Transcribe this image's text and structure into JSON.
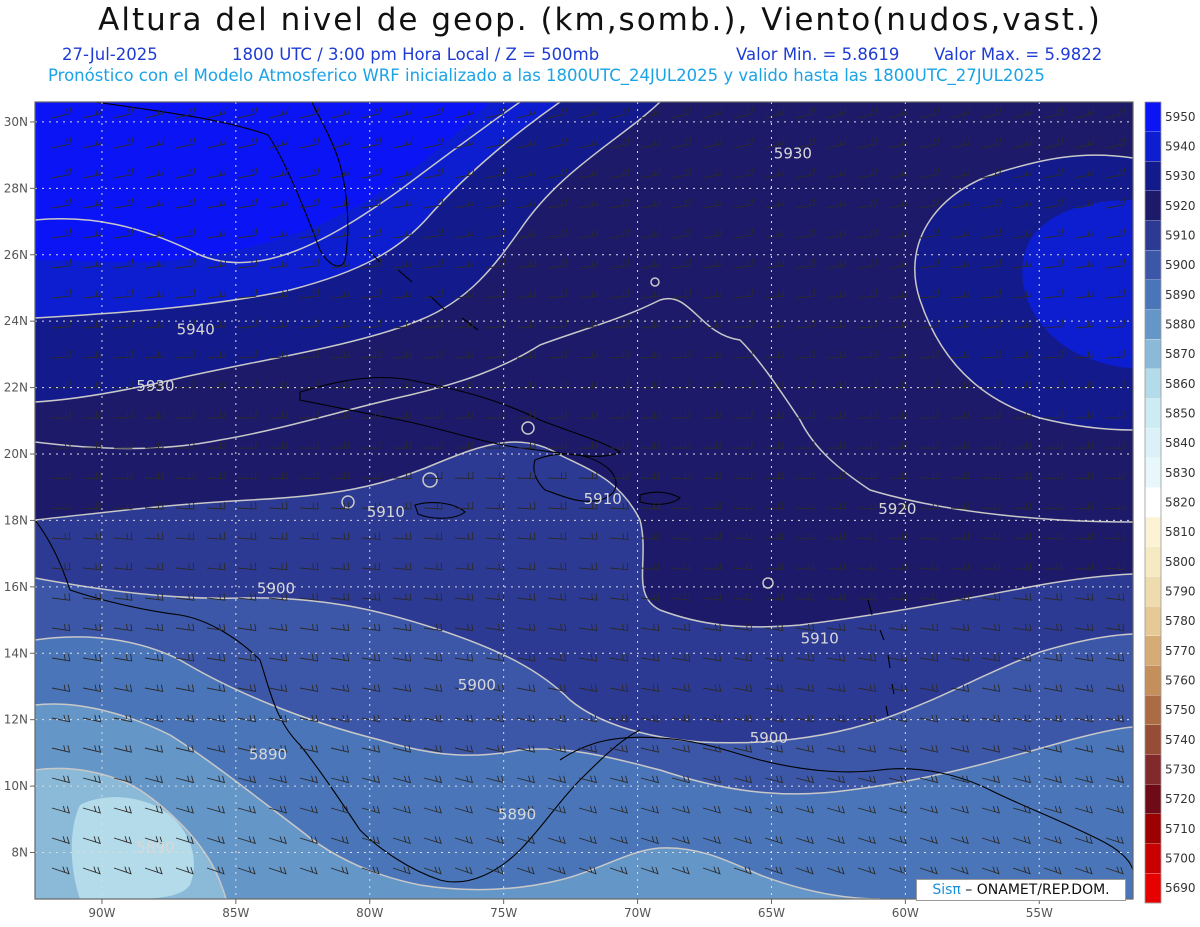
{
  "header": {
    "title": "Altura del nivel de geop. (km,somb.), Viento(nudos,vast.)",
    "date": "27-Jul-2025",
    "time": "1800 UTC / 3:00 pm Hora Local / Z = 500mb",
    "min": "Valor Min. = 5.8619",
    "max": "Valor Max. = 5.9822",
    "forecast": "Pronóstico con el Modelo Atmosferico WRF inicializado a las 1800UTC_24JUL2025 y valido hasta las  1800UTC_27JUL2025"
  },
  "map": {
    "lon_range": [
      -92.5,
      -51.5
    ],
    "lat_range": [
      6.6,
      30.6
    ],
    "lon_ticks": [
      {
        "value": -90,
        "label": "90W"
      },
      {
        "value": -85,
        "label": "85W"
      },
      {
        "value": -80,
        "label": "80W"
      },
      {
        "value": -75,
        "label": "75W"
      },
      {
        "value": -70,
        "label": "70W"
      },
      {
        "value": -65,
        "label": "65W"
      },
      {
        "value": -60,
        "label": "60W"
      },
      {
        "value": -55,
        "label": "55W"
      }
    ],
    "lat_ticks": [
      {
        "value": 8,
        "label": "8N"
      },
      {
        "value": 10,
        "label": "10N"
      },
      {
        "value": 12,
        "label": "12N"
      },
      {
        "value": 14,
        "label": "14N"
      },
      {
        "value": 16,
        "label": "16N"
      },
      {
        "value": 18,
        "label": "18N"
      },
      {
        "value": 20,
        "label": "20N"
      },
      {
        "value": 22,
        "label": "22N"
      },
      {
        "value": 24,
        "label": "24N"
      },
      {
        "value": 26,
        "label": "26N"
      },
      {
        "value": 28,
        "label": "28N"
      },
      {
        "value": 30,
        "label": "30N"
      }
    ],
    "contour_labels": [
      {
        "text": "5930",
        "lon": -64.2,
        "lat": 28.9
      },
      {
        "text": "5940",
        "lon": -86.5,
        "lat": 23.6
      },
      {
        "text": "5930",
        "lon": -88.0,
        "lat": 21.9
      },
      {
        "text": "5910",
        "lon": -79.4,
        "lat": 18.1
      },
      {
        "text": "5910",
        "lon": -71.3,
        "lat": 18.5
      },
      {
        "text": "5920",
        "lon": -60.3,
        "lat": 18.2
      },
      {
        "text": "5900",
        "lon": -83.5,
        "lat": 15.8
      },
      {
        "text": "5910",
        "lon": -63.2,
        "lat": 14.3
      },
      {
        "text": "5900",
        "lon": -76.0,
        "lat": 12.9
      },
      {
        "text": "5900",
        "lon": -65.1,
        "lat": 11.3
      },
      {
        "text": "5890",
        "lon": -74.5,
        "lat": 9.0
      },
      {
        "text": "5890",
        "lon": -88.0,
        "lat": 8.0
      },
      {
        "text": "5890",
        "lon": -83.8,
        "lat": 10.8
      }
    ]
  },
  "colorbar": {
    "levels": [
      {
        "value": "5950",
        "color": "#0a14f5"
      },
      {
        "value": "5940",
        "color": "#0d1ed1"
      },
      {
        "value": "5930",
        "color": "#131a8c"
      },
      {
        "value": "5920",
        "color": "#1d1a6a"
      },
      {
        "value": "5910",
        "color": "#2d3a94"
      },
      {
        "value": "5900",
        "color": "#3d57a8"
      },
      {
        "value": "5890",
        "color": "#4a76b9"
      },
      {
        "value": "5880",
        "color": "#6596c8"
      },
      {
        "value": "5870",
        "color": "#8bbad9"
      },
      {
        "value": "5860",
        "color": "#b4dbe9"
      },
      {
        "value": "5850",
        "color": "#cdebf3"
      },
      {
        "value": "5840",
        "color": "#dcf1f7"
      },
      {
        "value": "5830",
        "color": "#e8f7fb"
      },
      {
        "value": "5820",
        "color": "#ffffff"
      },
      {
        "value": "5810",
        "color": "#fbf3d3"
      },
      {
        "value": "5800",
        "color": "#f6eac2"
      },
      {
        "value": "5790",
        "color": "#efdcae"
      },
      {
        "value": "5780",
        "color": "#e6c995"
      },
      {
        "value": "5770",
        "color": "#d6ac76"
      },
      {
        "value": "5760",
        "color": "#c48f5b"
      },
      {
        "value": "5750",
        "color": "#ac6c43"
      },
      {
        "value": "5740",
        "color": "#974c36"
      },
      {
        "value": "5730",
        "color": "#82292b"
      },
      {
        "value": "5720",
        "color": "#6e0b16"
      },
      {
        "value": "5710",
        "color": "#9c0000"
      },
      {
        "value": "5700",
        "color": "#c80000"
      },
      {
        "value": "5690",
        "color": "#e60000"
      }
    ]
  },
  "credit": {
    "brand": "Sisπ",
    "text": " – ONAMET/REP.DOM."
  },
  "colors": {
    "frame": "#666666",
    "grid": "#dddddd",
    "contour": "#c8c8c8",
    "coast": "#000000"
  }
}
